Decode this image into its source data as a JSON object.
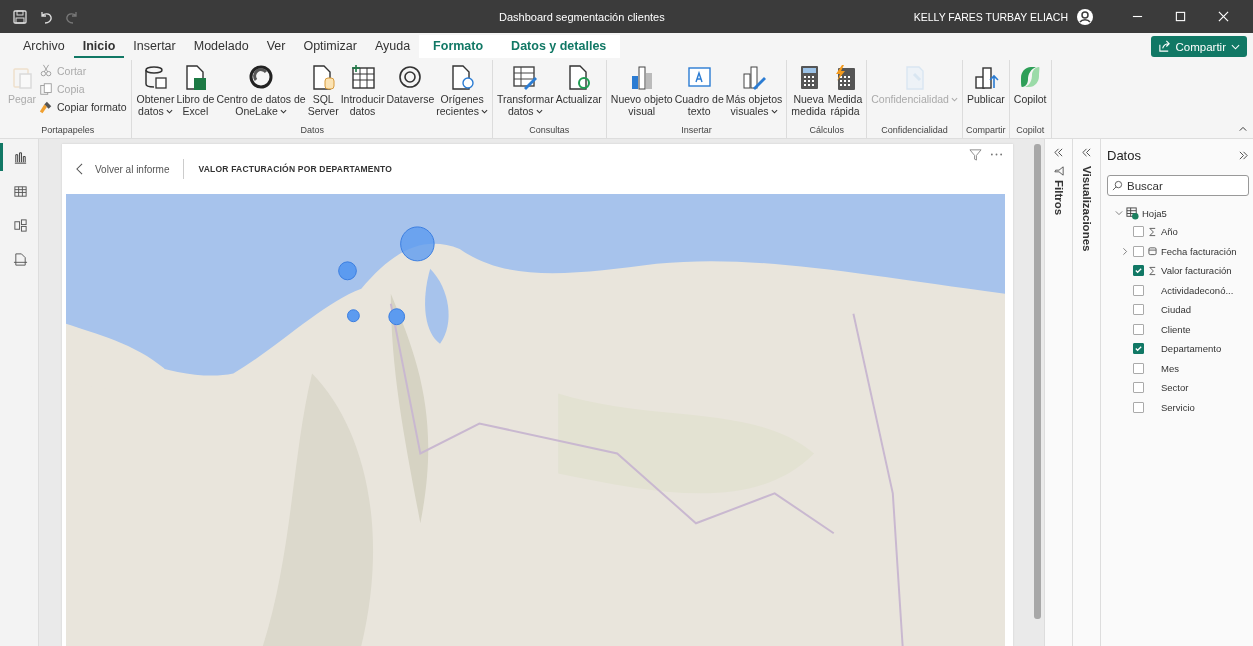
{
  "window": {
    "title": "Dashboard segmentación clientes",
    "user": "KELLY FARES TURBAY ELIACH"
  },
  "quick_access": [
    {
      "disabled": false
    },
    {
      "disabled": false
    },
    {
      "disabled": true
    }
  ],
  "tabs": [
    {
      "label": "Archivo",
      "kind": "standard",
      "selected": false
    },
    {
      "label": "Inicio",
      "kind": "standard",
      "selected": true
    },
    {
      "label": "Insertar",
      "kind": "standard",
      "selected": false
    },
    {
      "label": "Modelado",
      "kind": "standard",
      "selected": false
    },
    {
      "label": "Ver",
      "kind": "standard",
      "selected": false
    },
    {
      "label": "Optimizar",
      "kind": "standard",
      "selected": false
    },
    {
      "label": "Ayuda",
      "kind": "standard",
      "selected": false
    },
    {
      "label": "Formato",
      "kind": "contextual",
      "selected": false
    },
    {
      "label": "Datos y detalles",
      "kind": "contextual",
      "selected": false
    }
  ],
  "share_button": "Compartir",
  "ribbon": [
    {
      "label": "Portapapeles",
      "items": [
        {
          "kind": "large",
          "lines": [
            "Pegar"
          ],
          "dropdown": false,
          "disabled": true
        },
        {
          "kind": "stack",
          "items": [
            {
              "label": "Cortar",
              "disabled": true
            },
            {
              "label": "Copia",
              "disabled": true
            },
            {
              "label": "Copiar formato",
              "disabled": false
            }
          ]
        }
      ]
    },
    {
      "label": "Datos",
      "items": [
        {
          "kind": "large",
          "lines": [
            "Obtener",
            "datos"
          ],
          "dropdown": true,
          "disabled": false
        },
        {
          "kind": "large",
          "lines": [
            "Libro de",
            "Excel"
          ],
          "dropdown": false,
          "disabled": false
        },
        {
          "kind": "large",
          "lines": [
            "Centro de datos de",
            "OneLake"
          ],
          "dropdown": true,
          "disabled": false
        },
        {
          "kind": "large",
          "lines": [
            "SQL",
            "Server"
          ],
          "dropdown": false,
          "disabled": false
        },
        {
          "kind": "large",
          "lines": [
            "Introducir",
            "datos"
          ],
          "dropdown": false,
          "disabled": false
        },
        {
          "kind": "large",
          "lines": [
            "Dataverse"
          ],
          "dropdown": false,
          "disabled": false
        },
        {
          "kind": "large",
          "lines": [
            "Orígenes",
            "recientes"
          ],
          "dropdown": true,
          "disabled": false
        }
      ]
    },
    {
      "label": "Consultas",
      "items": [
        {
          "kind": "large",
          "lines": [
            "Transformar",
            "datos"
          ],
          "dropdown": true,
          "disabled": false
        },
        {
          "kind": "large",
          "lines": [
            "Actualizar"
          ],
          "dropdown": false,
          "disabled": false
        }
      ]
    },
    {
      "label": "Insertar",
      "items": [
        {
          "kind": "large",
          "lines": [
            "Nuevo objeto",
            "visual"
          ],
          "dropdown": false,
          "disabled": false
        },
        {
          "kind": "large",
          "lines": [
            "Cuadro de",
            "texto"
          ],
          "dropdown": false,
          "disabled": false
        },
        {
          "kind": "large",
          "lines": [
            "Más objetos",
            "visuales"
          ],
          "dropdown": true,
          "disabled": false
        }
      ]
    },
    {
      "label": "Cálculos",
      "items": [
        {
          "kind": "large",
          "lines": [
            "Nueva",
            "medida"
          ],
          "dropdown": false,
          "disabled": false
        },
        {
          "kind": "large",
          "lines": [
            "Medida",
            "rápida"
          ],
          "dropdown": false,
          "disabled": false
        }
      ]
    },
    {
      "label": "Confidencialidad",
      "items": [
        {
          "kind": "large",
          "lines": [
            "Confidencialidad"
          ],
          "dropdown": true,
          "disabled": true
        }
      ]
    },
    {
      "label": "Compartir",
      "items": [
        {
          "kind": "large",
          "lines": [
            "Publicar"
          ],
          "dropdown": false,
          "disabled": false
        }
      ]
    },
    {
      "label": "Copilot",
      "items": [
        {
          "kind": "large",
          "lines": [
            "Copilot"
          ],
          "dropdown": false,
          "disabled": false
        }
      ]
    }
  ],
  "left_nav": [
    {
      "selected": true
    },
    {
      "selected": false
    },
    {
      "selected": false
    },
    {
      "selected": false
    }
  ],
  "visual": {
    "back_link": "Volver al informe",
    "title": "VALOR FACTURACIÓN POR DEPARTAMENTO"
  },
  "panes": {
    "filters": "Filtros",
    "visualizations": "Visualizaciones",
    "data": {
      "title": "Datos",
      "search": {
        "placeholder": "Buscar"
      },
      "tables": [
        {
          "name": "Hoja5",
          "expanded": true,
          "fields": [
            {
              "label": "Año",
              "kind": "measure",
              "checked": false
            },
            {
              "label": "Fecha facturación",
              "kind": "hierarchy",
              "checked": false
            },
            {
              "label": "Valor facturación",
              "kind": "measure",
              "checked": true
            },
            {
              "label": "Actividadeconó...",
              "kind": "field",
              "checked": false
            },
            {
              "label": "Ciudad",
              "kind": "field",
              "checked": false
            },
            {
              "label": "Cliente",
              "kind": "field",
              "checked": false
            },
            {
              "label": "Departamento",
              "kind": "field",
              "checked": true
            },
            {
              "label": "Mes",
              "kind": "field",
              "checked": false
            },
            {
              "label": "Sector",
              "kind": "field",
              "checked": false
            },
            {
              "label": "Servicio",
              "kind": "field",
              "checked": false
            }
          ]
        }
      ]
    }
  }
}
